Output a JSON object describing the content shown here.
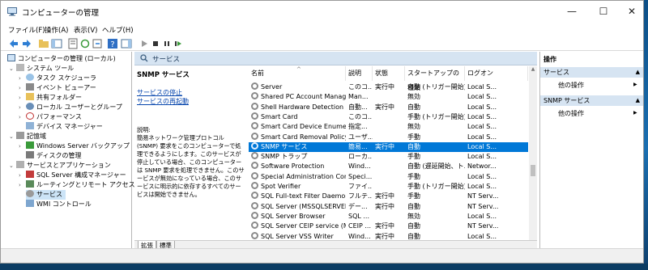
{
  "window": {
    "title": "コンピューターの管理",
    "minimize": "—",
    "maximize": "☐",
    "close": "✕"
  },
  "menu": [
    "ファイル(F)",
    "操作(A)",
    "表示(V)",
    "ヘルプ(H)"
  ],
  "tree": {
    "items": [
      {
        "label": "コンピューターの管理 (ローカル)",
        "arrow": ""
      },
      {
        "label": "システム ツール",
        "arrow": "v"
      },
      {
        "label": "タスク スケジューラ",
        "arrow": ">"
      },
      {
        "label": "イベント ビューアー",
        "arrow": ">"
      },
      {
        "label": "共有フォルダー",
        "arrow": ">"
      },
      {
        "label": "ローカル ユーザーとグループ",
        "arrow": ">"
      },
      {
        "label": "パフォーマンス",
        "arrow": ">"
      },
      {
        "label": "デバイス マネージャー",
        "arrow": ""
      },
      {
        "label": "記憶域",
        "arrow": "v"
      },
      {
        "label": "Windows Server バックアップ",
        "arrow": ">"
      },
      {
        "label": "ディスクの管理",
        "arrow": ""
      },
      {
        "label": "サービスとアプリケーション",
        "arrow": "v"
      },
      {
        "label": "SQL Server 構成マネージャー",
        "arrow": ">"
      },
      {
        "label": "ルーティングとリモート アクセス",
        "arrow": ">"
      },
      {
        "label": "サービス",
        "arrow": ""
      },
      {
        "label": "WMI コントロール",
        "arrow": ""
      }
    ]
  },
  "center": {
    "header": "サービス",
    "desc_title": "SNMP サービス",
    "link_stop": "サービスの停止",
    "link_restart": "サービスの再起動",
    "desc_label": "説明:",
    "desc_body": "簡易ネットワーク管理プロトコル (SNMP) 要求をこのコンピューターで処理できるようにします。このサービスが停止している場合、このコンピューターは SNMP 要求を処理できません。このサービスが無効になっている場合、このサービスに明示的に依存するすべてのサービスは開始できません。"
  },
  "columns": [
    "名前",
    "説明",
    "状態",
    "スタートアップの種類",
    "ログオン"
  ],
  "sort_indicator": "^",
  "services": [
    {
      "name": "Server",
      "desc": "このコ...",
      "status": "実行中",
      "startup": "自動 (トリガー開始)",
      "logon": "Local S..."
    },
    {
      "name": "Shared PC Account Manager",
      "desc": "Man...",
      "status": "",
      "startup": "無効",
      "logon": "Local S..."
    },
    {
      "name": "Shell Hardware Detection",
      "desc": "自動...",
      "status": "実行中",
      "startup": "自動",
      "logon": "Local S..."
    },
    {
      "name": "Smart Card",
      "desc": "このコ...",
      "status": "",
      "startup": "手動 (トリガー開始)",
      "logon": "Local S..."
    },
    {
      "name": "Smart Card Device Enumera...",
      "desc": "指定...",
      "status": "",
      "startup": "無効",
      "logon": "Local S..."
    },
    {
      "name": "Smart Card Removal Policy",
      "desc": "ユーザ...",
      "status": "",
      "startup": "手動",
      "logon": "Local S..."
    },
    {
      "name": "SNMP サービス",
      "desc": "簡易...",
      "status": "実行中",
      "startup": "自動",
      "logon": "Local S..."
    },
    {
      "name": "SNMP トラップ",
      "desc": "ローカ...",
      "status": "",
      "startup": "手動",
      "logon": "Local S..."
    },
    {
      "name": "Software Protection",
      "desc": "Wind...",
      "status": "",
      "startup": "自動 (遅延開始、ト...",
      "logon": "Networ..."
    },
    {
      "name": "Special Administration Cons...",
      "desc": "Speci...",
      "status": "",
      "startup": "手動",
      "logon": "Local S..."
    },
    {
      "name": "Spot Verifier",
      "desc": "ファイ...",
      "status": "",
      "startup": "手動 (トリガー開始)",
      "logon": "Local S..."
    },
    {
      "name": "SQL Full-text Filter Daemon ...",
      "desc": "フルテ...",
      "status": "実行中",
      "startup": "手動",
      "logon": "NT Serv..."
    },
    {
      "name": "SQL Server (MSSQLSERVER)",
      "desc": "デー...",
      "status": "実行中",
      "startup": "自動",
      "logon": "NT Serv..."
    },
    {
      "name": "SQL Server Browser",
      "desc": "SQL ...",
      "status": "",
      "startup": "無効",
      "logon": "Local S..."
    },
    {
      "name": "SQL Server CEIP service (MS...",
      "desc": "CEIP ...",
      "status": "実行中",
      "startup": "自動",
      "logon": "NT Serv..."
    },
    {
      "name": "SQL Server VSS Writer",
      "desc": "Wind...",
      "status": "実行中",
      "startup": "自動",
      "logon": "Local S..."
    }
  ],
  "tabs": {
    "ext": "拡張",
    "std": "標準"
  },
  "actions": {
    "header": "操作",
    "sec1": "サービス",
    "sec1_item": "他の操作",
    "sec2": "SNMP サービス",
    "sec2_item": "他の操作"
  },
  "colors": {
    "selection": "#0078d7",
    "header_bg": "#d6e4f2",
    "link": "#0645ad"
  }
}
